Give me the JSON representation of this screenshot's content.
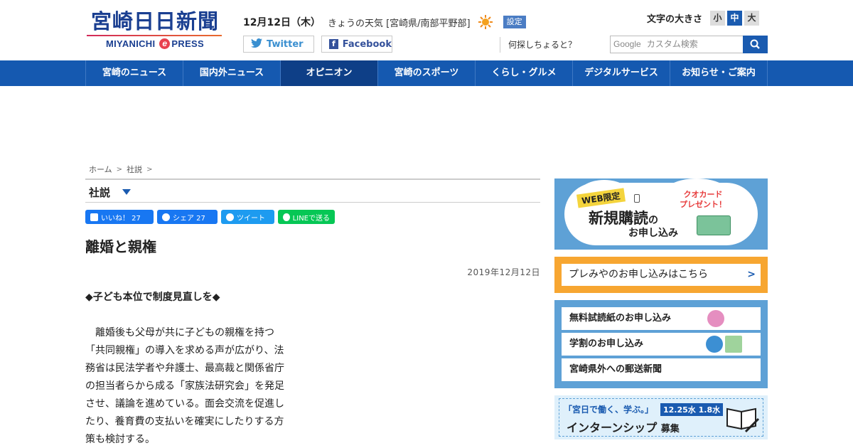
{
  "header": {
    "logo_main": "宮崎日日新聞",
    "logo_sub_left": "MIYANICHI",
    "logo_sub_e": "e",
    "logo_sub_right": "PRESS",
    "date": "12月12日（木）",
    "weather": "きょうの天気 [宮崎県/南部平野部]",
    "settings_label": "設定",
    "twitter_label": "Twitter",
    "facebook_label": "Facebook",
    "fontsize_label": "文字の大きさ",
    "fontsize_small": "小",
    "fontsize_medium": "中",
    "fontsize_large": "大",
    "search_question": "何探しちょると？",
    "search_google": "Google",
    "search_placeholder": "カスタム検索"
  },
  "nav": {
    "items": [
      {
        "label": "宮崎のニュース"
      },
      {
        "label": "国内外ニュース"
      },
      {
        "label": "オピニオン"
      },
      {
        "label": "宮崎のスポーツ"
      },
      {
        "label": "くらし・グルメ"
      },
      {
        "label": "デジタルサービス"
      },
      {
        "label": "お知らせ・ご案内"
      }
    ]
  },
  "breadcrumb": {
    "home": "ホーム",
    "current": "社説"
  },
  "section": {
    "title": "社説"
  },
  "share": {
    "like": "いいね！ 27",
    "share": "シェア 27",
    "tweet": "ツイート",
    "line": "LINEで送る"
  },
  "article": {
    "title": "離婚と親権",
    "date": "2019年12月12日",
    "subheading": "◆子ども本位で制度見直しを◆",
    "lines": [
      "　離婚後も父母が共に子どもの親権を持つ",
      "「共同親権」の導入を求める声が広がり、法",
      "務省は民法学者や弁護士、最高裁と関係省庁",
      "の担当者らから成る「家族法研究会」を発足",
      "させ、議論を進めている。面会交流を促進し",
      "たり、養育費の支払いを確実にしたりする方",
      "策も検討する。"
    ]
  },
  "sidebar": {
    "web_badge": "WEB限定",
    "quo": "クオカード",
    "quo2": "プレゼント！",
    "sub_big": "新規購読",
    "sub_no": "の",
    "sub_small": "お申し込み",
    "premi_link": "プレみやのお申し込みはこちら",
    "rows": [
      {
        "label": "無料試読紙のお申し込み"
      },
      {
        "label": "学割のお申し込み"
      },
      {
        "label": "宮崎県外への郵送新聞"
      }
    ],
    "intern_top": "「宮日で働く、学ぶ。」",
    "intern_dates": "12.25水 1.8水",
    "intern_main": "インターンシップ",
    "intern_suffix": "募集"
  }
}
